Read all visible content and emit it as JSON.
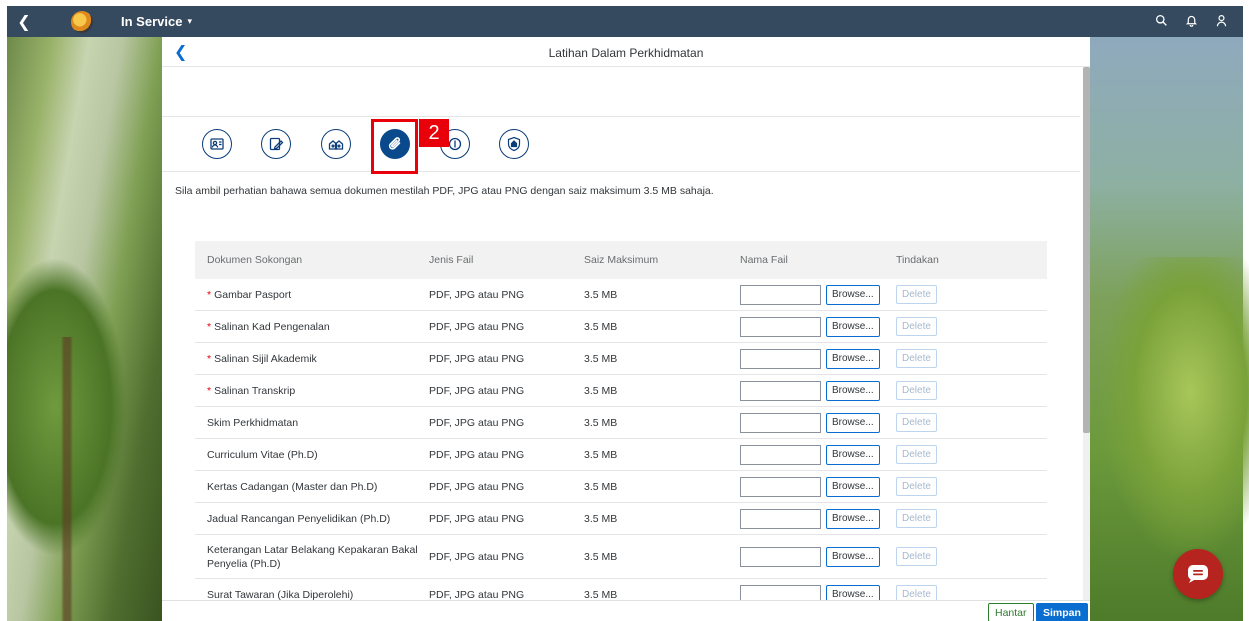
{
  "shell": {
    "app_title": "In Service",
    "title_caret": "▾"
  },
  "page": {
    "title": "Latihan Dalam Perkhidmatan"
  },
  "tabs": [
    {
      "icon": "personal-info-icon",
      "active": false
    },
    {
      "icon": "edit-form-icon",
      "active": false
    },
    {
      "icon": "family-icon",
      "active": false
    },
    {
      "icon": "attachment-icon",
      "active": true
    },
    {
      "icon": "money-icon",
      "active": false
    },
    {
      "icon": "shield-icon",
      "active": false
    }
  ],
  "annotation": {
    "step_number": "2"
  },
  "notice": "Sila ambil perhatian bahawa semua dokumen mestilah PDF, JPG atau PNG dengan saiz maksimum 3.5 MB sahaja.",
  "table": {
    "headers": [
      "Dokumen Sokongan",
      "Jenis Fail",
      "Saiz Maksimum",
      "Nama Fail",
      "Tindakan"
    ],
    "browse_label": "Browse...",
    "delete_label": "Delete",
    "required_mark": "*",
    "rows": [
      {
        "doc": "Gambar Pasport",
        "required": true,
        "type": "PDF, JPG atau PNG",
        "size": "3.5 MB"
      },
      {
        "doc": "Salinan Kad Pengenalan",
        "required": true,
        "type": "PDF, JPG atau PNG",
        "size": "3.5 MB"
      },
      {
        "doc": "Salinan Sijil Akademik",
        "required": true,
        "type": "PDF, JPG atau PNG",
        "size": "3.5 MB"
      },
      {
        "doc": "Salinan Transkrip",
        "required": true,
        "type": "PDF, JPG atau PNG",
        "size": "3.5 MB"
      },
      {
        "doc": "Skim Perkhidmatan",
        "required": false,
        "type": "PDF, JPG atau PNG",
        "size": "3.5 MB"
      },
      {
        "doc": "Curriculum Vitae (Ph.D)",
        "required": false,
        "type": "PDF, JPG atau PNG",
        "size": "3.5 MB"
      },
      {
        "doc": "Kertas Cadangan (Master dan Ph.D)",
        "required": false,
        "type": "PDF, JPG atau PNG",
        "size": "3.5 MB"
      },
      {
        "doc": "Jadual Rancangan Penyelidikan (Ph.D)",
        "required": false,
        "type": "PDF, JPG atau PNG",
        "size": "3.5 MB"
      },
      {
        "doc": "Keterangan Latar Belakang Kepakaran Bakal Penyelia (Ph.D)",
        "required": false,
        "type": "PDF, JPG atau PNG",
        "size": "3.5 MB",
        "tall": true
      },
      {
        "doc": "Surat Tawaran (Jika Diperolehi)",
        "required": false,
        "type": "PDF, JPG atau PNG",
        "size": "3.5 MB"
      }
    ]
  },
  "footer": {
    "submit_label": "Hantar",
    "save_label": "Simpan"
  },
  "colors": {
    "shell_bg": "#354a5f",
    "accent": "#0a6ed1",
    "highlight": "#e8000b",
    "chat_bg": "#b5241f"
  }
}
